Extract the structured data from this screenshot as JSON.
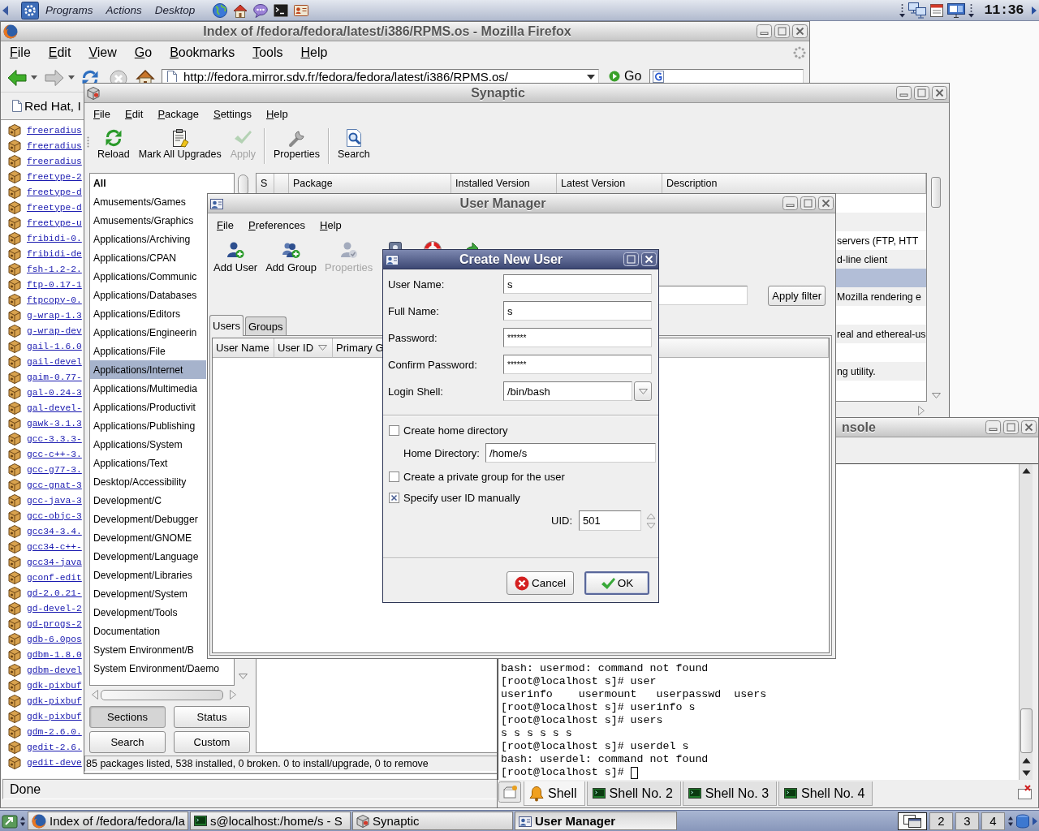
{
  "top_panel": {
    "menus": [
      "Programs",
      "Actions",
      "Desktop"
    ],
    "clock": "11:36"
  },
  "browser": {
    "title": "Index of /fedora/fedora/latest/i386/RPMS.os - Mozilla Firefox",
    "menu": [
      "File",
      "Edit",
      "View",
      "Go",
      "Bookmarks",
      "Tools",
      "Help"
    ],
    "address": "http://fedora.mirror.sdv.fr/fedora/fedora/latest/i386/RPMS.os/",
    "go_button": "Go",
    "bookmarks": [
      "Red Hat, I"
    ],
    "files": [
      "freeradius",
      "freeradius",
      "freeradius",
      "freetype-2",
      "freetype-d",
      "freetype-d",
      "freetype-u",
      "fribidi-0.",
      "fribidi-de",
      "fsh-1.2-2.",
      "ftp-0.17-1",
      "ftpcopy-0.",
      "g-wrap-1.3",
      "g-wrap-dev",
      "gail-1.6.0",
      "gail-devel",
      "gaim-0.77-",
      "gal-0.24-3",
      "gal-devel-",
      "gawk-3.1.3",
      "gcc-3.3.3-",
      "gcc-c++-3.",
      "gcc-g77-3.",
      "gcc-gnat-3",
      "gcc-java-3",
      "gcc-objc-3",
      "gcc34-3.4.",
      "gcc34-c++-",
      "gcc34-java",
      "gconf-edit",
      "gd-2.0.21-",
      "gd-devel-2",
      "gd-progs-2",
      "gdb-6.0pos",
      "gdbm-1.8.0",
      "gdbm-devel",
      "gdk-pixbuf",
      "gdk-pixbuf",
      "gdk-pixbuf",
      "gdm-2.6.0.",
      "gedit-2.6.",
      "gedit-deve"
    ],
    "status": "Done"
  },
  "synaptic": {
    "title": "Synaptic",
    "menu": [
      "File",
      "Edit",
      "Package",
      "Settings",
      "Help"
    ],
    "toolbar": [
      {
        "label": "Reload",
        "kind": "reload",
        "disabled": false,
        "separator": false
      },
      {
        "label": "Mark All Upgrades",
        "kind": "upgrade",
        "disabled": false,
        "separator": false
      },
      {
        "label": "Apply",
        "kind": "apply",
        "disabled": true,
        "separator": false
      },
      {
        "label": "Properties",
        "kind": "properties",
        "disabled": false,
        "separator": true
      },
      {
        "label": "Search",
        "kind": "search",
        "disabled": false,
        "separator": true
      }
    ],
    "sections": [
      {
        "label": "All",
        "kind": "header",
        "selected": false
      },
      {
        "label": "Amusements/Games",
        "kind": "section",
        "selected": false
      },
      {
        "label": "Amusements/Graphics",
        "kind": "section",
        "selected": false
      },
      {
        "label": "Applications/Archiving",
        "kind": "section",
        "selected": false
      },
      {
        "label": "Applications/CPAN",
        "kind": "section",
        "selected": false
      },
      {
        "label": "Applications/Communic",
        "kind": "section",
        "selected": false
      },
      {
        "label": "Applications/Databases",
        "kind": "section",
        "selected": false
      },
      {
        "label": "Applications/Editors",
        "kind": "section",
        "selected": false
      },
      {
        "label": "Applications/Engineerin",
        "kind": "section",
        "selected": false
      },
      {
        "label": "Applications/File",
        "kind": "section",
        "selected": false
      },
      {
        "label": "Applications/Internet",
        "kind": "section",
        "selected": true
      },
      {
        "label": "Applications/Multimedia",
        "kind": "section",
        "selected": false
      },
      {
        "label": "Applications/Productivit",
        "kind": "section",
        "selected": false
      },
      {
        "label": "Applications/Publishing",
        "kind": "section",
        "selected": false
      },
      {
        "label": "Applications/System",
        "kind": "section",
        "selected": false
      },
      {
        "label": "Applications/Text",
        "kind": "section",
        "selected": false
      },
      {
        "label": "Desktop/Accessibility",
        "kind": "section",
        "selected": false
      },
      {
        "label": "Development/C",
        "kind": "section",
        "selected": false
      },
      {
        "label": "Development/Debugger",
        "kind": "section",
        "selected": false
      },
      {
        "label": "Development/GNOME",
        "kind": "section",
        "selected": false
      },
      {
        "label": "Development/Language",
        "kind": "section",
        "selected": false
      },
      {
        "label": "Development/Libraries",
        "kind": "section",
        "selected": false
      },
      {
        "label": "Development/System",
        "kind": "section",
        "selected": false
      },
      {
        "label": "Development/Tools",
        "kind": "section",
        "selected": false
      },
      {
        "label": "Documentation",
        "kind": "section",
        "selected": false
      },
      {
        "label": "System Environment/B",
        "kind": "section",
        "selected": false
      },
      {
        "label": "System Environment/Daemo",
        "kind": "section",
        "selected": false
      }
    ],
    "table": {
      "columns": [
        "S",
        "Package",
        "Installed Version",
        "Latest Version",
        "Description"
      ],
      "rows": [
        {
          "selected": false
        },
        {
          "selected": false
        },
        {
          "description": "servers (FTP, HTT",
          "selected": false
        },
        {
          "description": "d-line client",
          "selected": false
        },
        {
          "selected": true
        },
        {
          "description": "Mozilla rendering e",
          "selected": false
        },
        {
          "selected": false
        },
        {
          "description": "real and ethereal-us",
          "selected": false
        },
        {
          "selected": false
        },
        {
          "description": "ng utility.",
          "selected": false
        },
        {
          "selected": false
        }
      ]
    },
    "filters": [
      {
        "label": "Sections",
        "selected": true
      },
      {
        "label": "Status",
        "selected": false
      },
      {
        "label": "Search",
        "selected": false
      },
      {
        "label": "Custom",
        "selected": false
      }
    ],
    "status_bar": "85 packages listed, 538 installed, 0 broken. 0 to install/upgrade, 0 to remove"
  },
  "user_manager": {
    "title": "User Manager",
    "menu": [
      "File",
      "Preferences",
      "Help"
    ],
    "toolbar": [
      {
        "label": "Add User",
        "kind": "add-user",
        "disabled": false
      },
      {
        "label": "Add Group",
        "kind": "add-group",
        "disabled": false
      },
      {
        "label": "Properties",
        "kind": "properties",
        "disabled": true
      },
      {
        "kind": "delete",
        "disabled": false
      },
      {
        "kind": "help",
        "disabled": false
      },
      {
        "kind": "refresh",
        "disabled": false
      }
    ],
    "apply_filter": "Apply filter",
    "tabs": [
      {
        "label": "Users",
        "selected": true
      },
      {
        "label": "Groups",
        "selected": false
      }
    ],
    "columns": [
      {
        "label": "User Name",
        "sorted": false
      },
      {
        "label": "User ID",
        "sorted": true
      },
      {
        "label": "Primary G",
        "sorted": false
      }
    ]
  },
  "dialog": {
    "title": "Create New User",
    "fields": [
      {
        "label": "User Name:",
        "value": "s",
        "kind": "text"
      },
      {
        "label": "Full Name:",
        "value": "s",
        "kind": "text"
      },
      {
        "label": "Password:",
        "value": "******",
        "kind": "password"
      },
      {
        "label": "Confirm Password:",
        "value": "******",
        "kind": "password"
      },
      {
        "label": "Login Shell:",
        "value": "/bin/bash",
        "kind": "combo"
      }
    ],
    "options": [
      {
        "label": "Create home directory",
        "checked": false,
        "field": {
          "label": "Home Directory:",
          "value": "/home/s",
          "kind": "text"
        }
      },
      {
        "label": "Create a private group for the user",
        "checked": false
      },
      {
        "label": "Specify user ID manually",
        "checked": true,
        "field": {
          "label": "UID:",
          "value": "501",
          "kind": "spin"
        }
      }
    ],
    "buttons": [
      {
        "label": "Cancel",
        "kind": "cancel",
        "default": false
      },
      {
        "label": "OK",
        "kind": "ok",
        "default": true
      }
    ]
  },
  "console": {
    "title": "nsole",
    "lines": [
      "bash: usermod: command not found",
      "[root@localhost s]# user",
      "userinfo    usermount   userpasswd  users",
      "[root@localhost s]# userinfo s",
      "[root@localhost s]# users",
      "s s s s s s",
      "[root@localhost s]# userdel s",
      "bash: userdel: command not found",
      "[root@localhost s]#"
    ],
    "cursor": true,
    "tabs": [
      {
        "label": "Shell",
        "kind": "bell",
        "selected": true
      },
      {
        "label": "Shell No. 2",
        "kind": "terminal",
        "selected": false
      },
      {
        "label": "Shell No. 3",
        "kind": "terminal",
        "selected": false
      },
      {
        "label": "Shell No. 4",
        "kind": "terminal",
        "selected": false
      }
    ]
  },
  "taskbar": {
    "tasks": [
      {
        "label": "Index of /fedora/fedora/la",
        "kind": "browser",
        "selected": false
      },
      {
        "label": "s@localhost:/home/s - S",
        "kind": "terminal",
        "selected": false
      },
      {
        "label": "Synaptic",
        "kind": "package",
        "selected": false
      },
      {
        "label": "User Manager",
        "kind": "users",
        "selected": true
      }
    ],
    "desktops": [
      {
        "selected": true
      },
      {
        "label": "2",
        "selected": false
      },
      {
        "label": "3",
        "selected": false
      },
      {
        "label": "4",
        "selected": false
      }
    ]
  }
}
